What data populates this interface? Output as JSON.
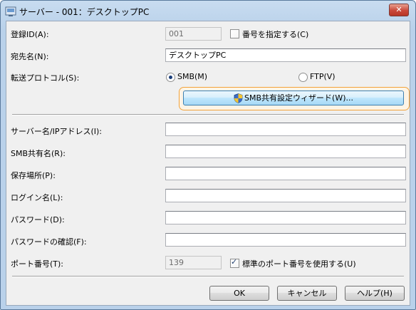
{
  "window": {
    "title": "サーバー - 001：デスクトップPC",
    "close_label": "✕"
  },
  "registration": {
    "label": "登録ID(A):",
    "value": "001",
    "specify_checkbox_label": "番号を指定する(C)",
    "specify_checked": false
  },
  "destination": {
    "label": "宛先名(N):",
    "value": "デスクトップPC"
  },
  "protocol": {
    "label": "転送プロトコル(S):",
    "options": [
      {
        "label": "SMB(M)",
        "selected": true
      },
      {
        "label": "FTP(V)",
        "selected": false
      }
    ]
  },
  "wizard_button": {
    "label": "SMB共有設定ウィザード(W)..."
  },
  "fields": [
    {
      "label": "サーバー名/IPアドレス(I):",
      "value": ""
    },
    {
      "label": "SMB共有名(R):",
      "value": ""
    },
    {
      "label": "保存場所(P):",
      "value": ""
    },
    {
      "label": "ログイン名(L):",
      "value": ""
    },
    {
      "label": "パスワード(D):",
      "value": ""
    },
    {
      "label": "パスワードの確認(F):",
      "value": ""
    }
  ],
  "port": {
    "label": "ポート番号(T):",
    "value": "139",
    "standard_checkbox_label": "標準のポート番号を使用する(U)",
    "standard_checked": true
  },
  "buttons": {
    "ok": "OK",
    "cancel": "キャンセル",
    "help": "ヘルプ(H)"
  }
}
